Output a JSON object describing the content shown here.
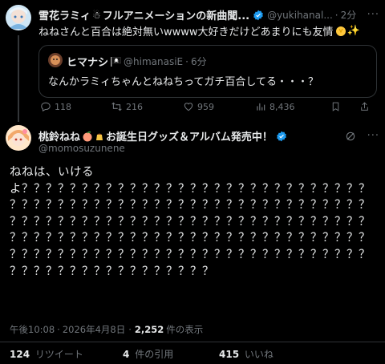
{
  "reply_tweet": {
    "author_name": "雪花ラミィ",
    "author_name_suffix": "フルアニメーションの新曲聞...",
    "handle": "@yukihanal...",
    "time": "2分",
    "text": "ねねさんと百合は絶対無いwwww大好きだけどあまりにも友情",
    "quote": {
      "author_name": "ヒマナシ",
      "handle": "@himanasiE",
      "time": "6分",
      "text": "なんかラミィちゃんとねねちってガチ百合してる・・・？"
    },
    "actions": {
      "replies": "118",
      "reposts": "216",
      "likes": "959",
      "views": "8,436"
    }
  },
  "main_tweet": {
    "author_name": "桃鈴ねね",
    "author_name_suffix": "お誕生日グッズ＆アルバム発売中！",
    "handle": "@momosuzunene",
    "text": "ねねは、いけるよ？？？？？？？？？？？？？？？？？？？？？？？？？？？？？？？？？？？？？？？？？？？？？？？？？？？？？？？？？？？？？？？？？？？？？？？？？？？？？？？？？？？？？？？？？？？？？？？？？？？？？？？？？？？？？？？？？？？？？？？？？？？？？？？？？？？？？？？？？？？？？？？？？？？？？？？？？？？？？？？？？？？？？？",
    "meta": {
      "time": "午後10:08",
      "date": "2026年4月8日",
      "views_count": "2,252",
      "views_label": "件の表示"
    },
    "stats": {
      "reposts_count": "124",
      "reposts_label": "リツイート",
      "quotes_count": "4",
      "quotes_label": "件の引用",
      "likes_count": "415",
      "likes_label": "いいね"
    }
  },
  "colors": {
    "verified": "#1d9bf0",
    "background": "#000000",
    "muted": "#71767b"
  }
}
